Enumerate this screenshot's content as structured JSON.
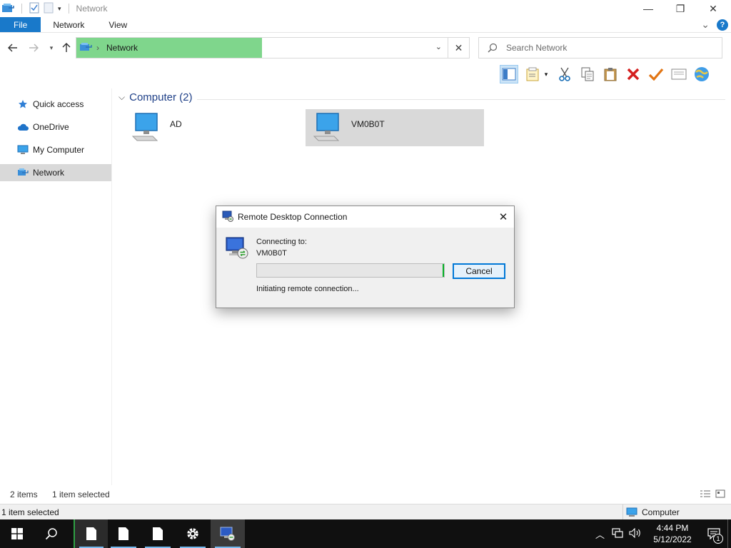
{
  "window": {
    "title": "Network",
    "controls": {
      "minimize": "—",
      "maximize": "❐",
      "close": "✕"
    }
  },
  "ribbon": {
    "tabs": [
      {
        "label": "File"
      },
      {
        "label": "Network"
      },
      {
        "label": "View"
      }
    ],
    "expand_glyph": "⌄",
    "help_glyph": "?"
  },
  "address": {
    "crumbs": [
      "Network"
    ],
    "separator": "›",
    "dropdown_glyph": "⌄",
    "clear_glyph": "✕"
  },
  "search": {
    "placeholder": "Search Network"
  },
  "navpane": {
    "items": [
      {
        "label": "Quick access",
        "icon": "star-icon"
      },
      {
        "label": "OneDrive",
        "icon": "cloud-icon"
      },
      {
        "label": "My Computer",
        "icon": "computer-icon"
      },
      {
        "label": "Network",
        "icon": "network-icon",
        "selected": true
      }
    ]
  },
  "content": {
    "group_header": "Computer (2)",
    "items": [
      {
        "name": "AD",
        "selected": false
      },
      {
        "name": "VM0B0T",
        "selected": true
      }
    ]
  },
  "dialog": {
    "title": "Remote Desktop Connection",
    "connecting_label": "Connecting to:",
    "target": "VM0B0T",
    "cancel_label": "Cancel",
    "status": "Initiating remote connection...",
    "close_glyph": "✕"
  },
  "status_bar": {
    "item_count": "2 items",
    "selection": "1 item selected"
  },
  "status_bar2": {
    "left": "1 item selected",
    "zone": "Computer"
  },
  "taskbar": {
    "time": "4:44 PM",
    "date": "5/12/2022",
    "notifications_count": "1"
  },
  "colors": {
    "accent": "#1979ca",
    "address_highlight": "#7fd68c",
    "selection": "#d9d9d9",
    "taskbar": "#101010",
    "group_header": "#1e3f87"
  }
}
